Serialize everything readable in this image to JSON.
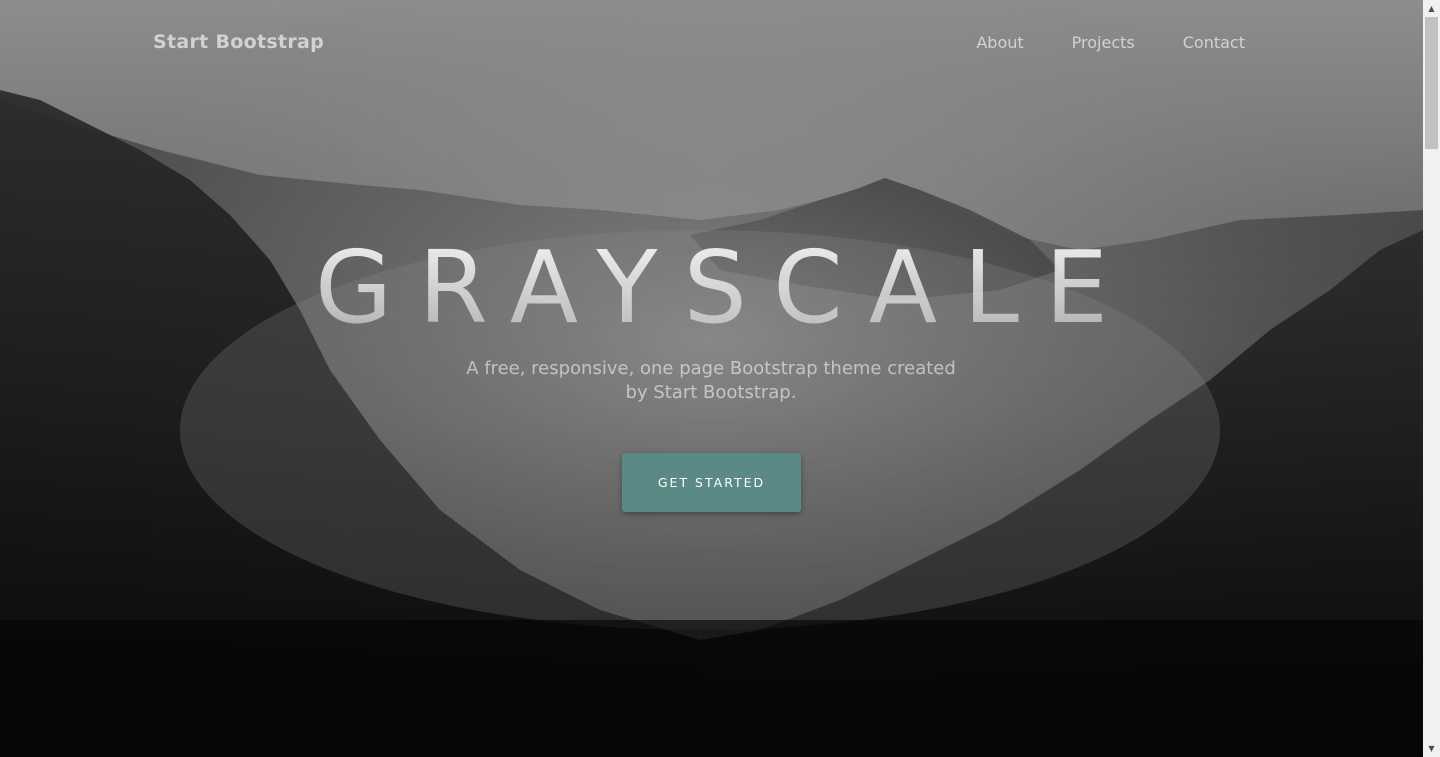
{
  "navbar": {
    "brand": "Start Bootstrap",
    "links": [
      "About",
      "Projects",
      "Contact"
    ]
  },
  "hero": {
    "title": "GRAYSCALE",
    "subtitle": "A free, responsive, one page Bootstrap theme created by Start Bootstrap.",
    "button_label": "Get Started"
  },
  "colors": {
    "accent": "#5b8a86",
    "text_muted": "#bdbdbd"
  },
  "icons": {
    "scroll_up": "triangle-up-icon",
    "scroll_down": "triangle-down-icon"
  }
}
